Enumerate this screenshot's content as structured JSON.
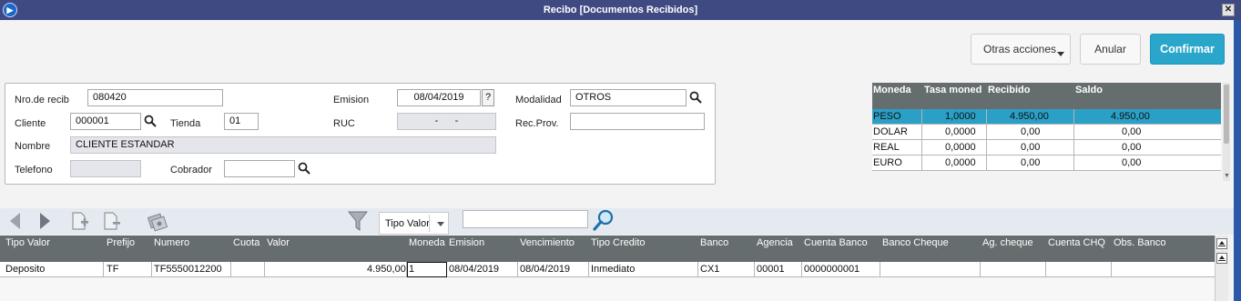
{
  "window": {
    "title": "Recibo [Documentos Recibidos]",
    "close_glyph": "✕"
  },
  "toolbar": {
    "otras_label": "Otras acciones",
    "anular_label": "Anular",
    "confirmar_label": "Confirmar"
  },
  "form": {
    "nro_recib_label": "Nro.de recib",
    "nro_recib_value": "080420",
    "emision_label": "Emision",
    "emision_value": "08/04/2019",
    "help_glyph": "?",
    "modalidad_label": "Modalidad",
    "modalidad_value": "OTROS",
    "cliente_label": "Cliente",
    "cliente_value": "000001",
    "tienda_label": "Tienda",
    "tienda_value": "01",
    "ruc_label": "RUC",
    "ruc_value": "-      -",
    "recprov_label": "Rec.Prov.",
    "recprov_value": "",
    "nombre_label": "Nombre",
    "nombre_value": "CLIENTE ESTANDAR",
    "telefono_label": "Telefono",
    "telefono_value": "",
    "cobrador_label": "Cobrador",
    "cobrador_value": ""
  },
  "currency_table": {
    "headers": [
      "Moneda",
      "Tasa moned",
      "Recibido",
      "Saldo"
    ],
    "rows": [
      [
        "PESO",
        "1,0000",
        "4.950,00",
        "4.950,00"
      ],
      [
        "DOLAR",
        "0,0000",
        "0,00",
        "0,00"
      ],
      [
        "REAL",
        "0,0000",
        "0,00",
        "0,00"
      ],
      [
        "EURO",
        "0,0000",
        "0,00",
        "0,00"
      ]
    ]
  },
  "grid_toolbar": {
    "tipo_select": "Tipo Valor",
    "search_value": ""
  },
  "grid": {
    "headers": [
      "Tipo Valor",
      "Prefijo",
      "Numero",
      "Cuota",
      "Valor",
      "Moneda",
      "Emision",
      "Vencimiento",
      "Tipo Credito",
      "Banco",
      "Agencia",
      "Cuenta Banco",
      "Banco Cheque",
      "Ag. cheque",
      "Cuenta CHQ",
      "Obs. Banco"
    ],
    "rows": [
      [
        "Deposito",
        "TF",
        "TF5550012200",
        "",
        "4.950,00",
        "1",
        "08/04/2019",
        "08/04/2019",
        "Inmediato",
        "CX1",
        "00001",
        "0000000001",
        "",
        "",
        "",
        ""
      ]
    ]
  },
  "colors": {
    "titlebar": "#3f4a82",
    "accent": "#2ba6cb",
    "grid_header": "#656d6e",
    "selected_row": "#2aa0c6"
  },
  "icons": [
    "app-icon",
    "close-icon",
    "caret-down-icon",
    "help-icon",
    "search-icon",
    "prev-arrow-icon",
    "next-arrow-icon",
    "add-doc-icon",
    "edit-doc-icon",
    "money-icon",
    "filter-icon",
    "magnifier-icon",
    "scroll-top-icon",
    "scroll-up-icon"
  ]
}
